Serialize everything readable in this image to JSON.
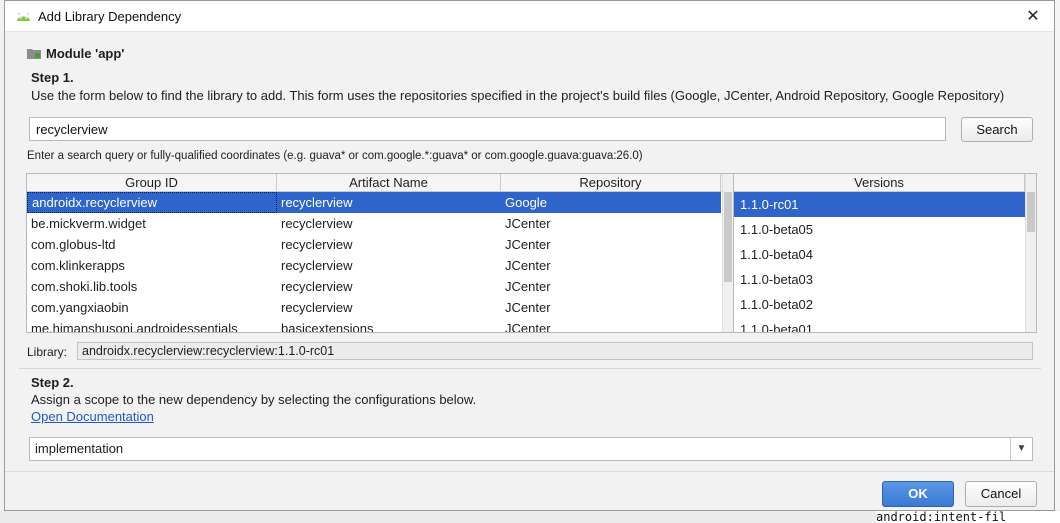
{
  "window": {
    "title": "Add Library Dependency",
    "close_glyph": "✕"
  },
  "module": {
    "label": "Module 'app'"
  },
  "step1": {
    "title": "Step 1.",
    "description": "Use the form below to find the library to add. This form uses the repositories specified in the project's build files (Google, JCenter, Android Repository, Google Repository)"
  },
  "search": {
    "value": "recyclerview",
    "button_label": "Search",
    "hint": "Enter a search query or fully-qualified coordinates (e.g. guava* or com.google.*:guava* or com.google.guava:guava:26.0)"
  },
  "results": {
    "columns": [
      "Group ID",
      "Artifact Name",
      "Repository"
    ],
    "rows": [
      {
        "group": "androidx.recyclerview",
        "artifact": "recyclerview",
        "repo": "Google"
      },
      {
        "group": "be.mickverm.widget",
        "artifact": "recyclerview",
        "repo": "JCenter"
      },
      {
        "group": "com.globus-ltd",
        "artifact": "recyclerview",
        "repo": "JCenter"
      },
      {
        "group": "com.klinkerapps",
        "artifact": "recyclerview",
        "repo": "JCenter"
      },
      {
        "group": "com.shoki.lib.tools",
        "artifact": "recyclerview",
        "repo": "JCenter"
      },
      {
        "group": "com.yangxiaobin",
        "artifact": "recyclerview",
        "repo": "JCenter"
      },
      {
        "group": "me.himanshusoni.androidessentials",
        "artifact": "basicextensions",
        "repo": "JCenter"
      }
    ]
  },
  "versions": {
    "header": "Versions",
    "items": [
      "1.1.0-rc01",
      "1.1.0-beta05",
      "1.1.0-beta04",
      "1.1.0-beta03",
      "1.1.0-beta02",
      "1.1.0-beta01"
    ]
  },
  "library": {
    "label": "Library:",
    "value": "androidx.recyclerview:recyclerview:1.1.0-rc01"
  },
  "step2": {
    "title": "Step 2.",
    "description": "Assign a scope to the new dependency by selecting the configurations below.",
    "link": "Open Documentation",
    "scope_value": "implementation",
    "arrow_glyph": "▼"
  },
  "footer": {
    "ok_label": "OK",
    "cancel_label": "Cancel"
  },
  "background": {
    "code_snippet": "android:intent-fil"
  },
  "colors": {
    "selection": "#2f65ca",
    "link": "#2058c7",
    "ok_button": "#3b79d3"
  },
  "icons": {
    "app": "android-icon",
    "module": "folder-icon",
    "close": "close-icon",
    "dropdown": "chevron-down-icon"
  }
}
